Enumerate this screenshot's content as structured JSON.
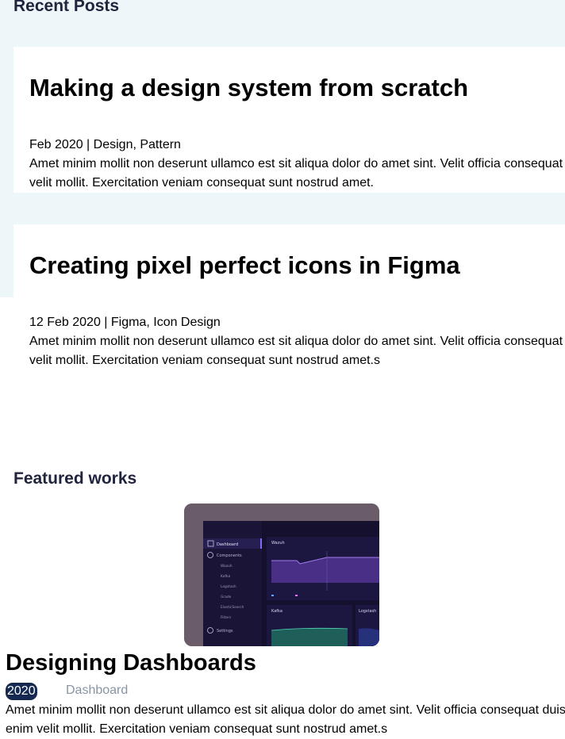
{
  "recent": {
    "heading": "Recent Posts",
    "posts": [
      {
        "title": "Making a design system from scratch",
        "meta": "Feb 2020 | Design, Pattern",
        "excerpt": "Amet minim mollit non deserunt ullamco est sit aliqua dolor do amet sint. Velit officia consequat\nvelit mollit. Exercitation veniam consequat sunt nostrud amet."
      },
      {
        "title": "Creating pixel perfect icons in Figma",
        "meta": "12 Feb 2020 | Figma, Icon Design",
        "excerpt": "Amet minim mollit non deserunt ullamco est sit aliqua dolor do amet sint. Velit officia consequat\nvelit mollit. Exercitation veniam consequat sunt nostrud amet.s"
      }
    ]
  },
  "featured": {
    "heading": "Featured works",
    "work": {
      "title": "Designing Dashboards",
      "year": "2020",
      "tag": "Dashboard",
      "description": "Amet minim mollit non deserunt ullamco est sit aliqua dolor do amet sint. Velit officia consequat duis\nenim velit mollit. Exercitation veniam consequat sunt nostrud amet.s",
      "thumbnail": {
        "sidebar_items": [
          "Dashboard",
          "Components",
          "Wazuh",
          "Kafka",
          "Logstash",
          "Grade",
          "ElasticSearch",
          "Filters",
          "Settings"
        ],
        "panel_titles": [
          "Wazuh",
          "Kafka",
          "Logstash"
        ]
      }
    }
  },
  "colors": {
    "band_bg": "#edf6f9",
    "heading": "#21243d",
    "badge_bg": "#142850",
    "tag_text": "#8695a4"
  }
}
